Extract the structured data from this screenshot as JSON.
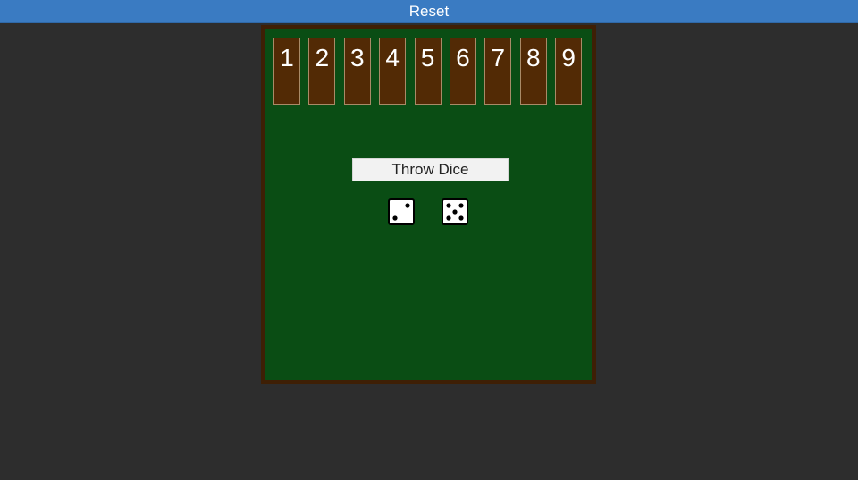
{
  "header": {
    "reset_label": "Reset"
  },
  "board": {
    "tiles": [
      "1",
      "2",
      "3",
      "4",
      "5",
      "6",
      "7",
      "8",
      "9"
    ],
    "throw_label": "Throw Dice",
    "dice": [
      2,
      5
    ]
  },
  "colors": {
    "header_bg": "#3a7bc2",
    "page_bg": "#2d2d2d",
    "felt": "#0a4d14",
    "frame": "#3e1f05",
    "tile": "#522a05"
  }
}
